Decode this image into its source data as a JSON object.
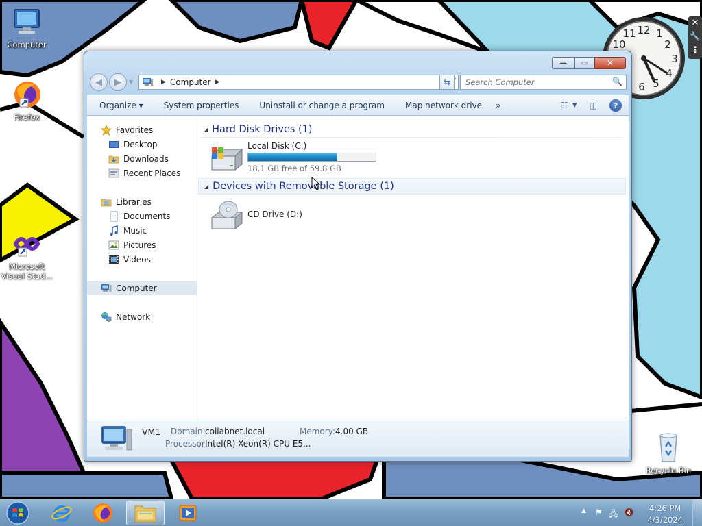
{
  "desktop": {
    "icons": [
      {
        "label": "Computer"
      },
      {
        "label": "Firefox"
      },
      {
        "label": "Microsoft Visual Stud..."
      },
      {
        "label": "Recycle Bin"
      }
    ]
  },
  "window": {
    "buttons": {
      "minimize": "—",
      "maximize": "▭",
      "close": "✕"
    },
    "address": {
      "crumbs": [
        "Computer"
      ]
    },
    "search": {
      "placeholder": "Search Computer"
    },
    "toolbar": {
      "organize": "Organize ▾",
      "system_properties": "System properties",
      "uninstall": "Uninstall or change a program",
      "map_drive": "Map network drive",
      "more": "»"
    },
    "nav": {
      "favorites": "Favorites",
      "desktop": "Desktop",
      "downloads": "Downloads",
      "recent": "Recent Places",
      "libraries": "Libraries",
      "documents": "Documents",
      "music": "Music",
      "pictures": "Pictures",
      "videos": "Videos",
      "computer": "Computer",
      "network": "Network"
    },
    "content": {
      "groups": [
        {
          "title": "Hard Disk Drives (1)"
        },
        {
          "title": "Devices with Removable Storage (1)"
        }
      ],
      "drives": [
        {
          "name": "Local Disk (C:)",
          "usage": "18.1 GB free of 59.8 GB",
          "used_fraction": 0.7
        },
        {
          "name": "CD Drive (D:)"
        }
      ]
    },
    "details": {
      "name": "VM1",
      "domain_label": "Domain:",
      "domain": "collabnet.local",
      "memory_label": "Memory:",
      "memory": "4.00 GB",
      "processor_label": "Processor:",
      "processor": "Intel(R) Xeon(R) CPU E5..."
    }
  },
  "taskbar": {
    "time": "4:26 PM",
    "date": "4/3/2024"
  },
  "colors": {
    "group_heading": "#1e3287",
    "progress": "#1c85be",
    "window_frame": "#b9d4ee"
  }
}
